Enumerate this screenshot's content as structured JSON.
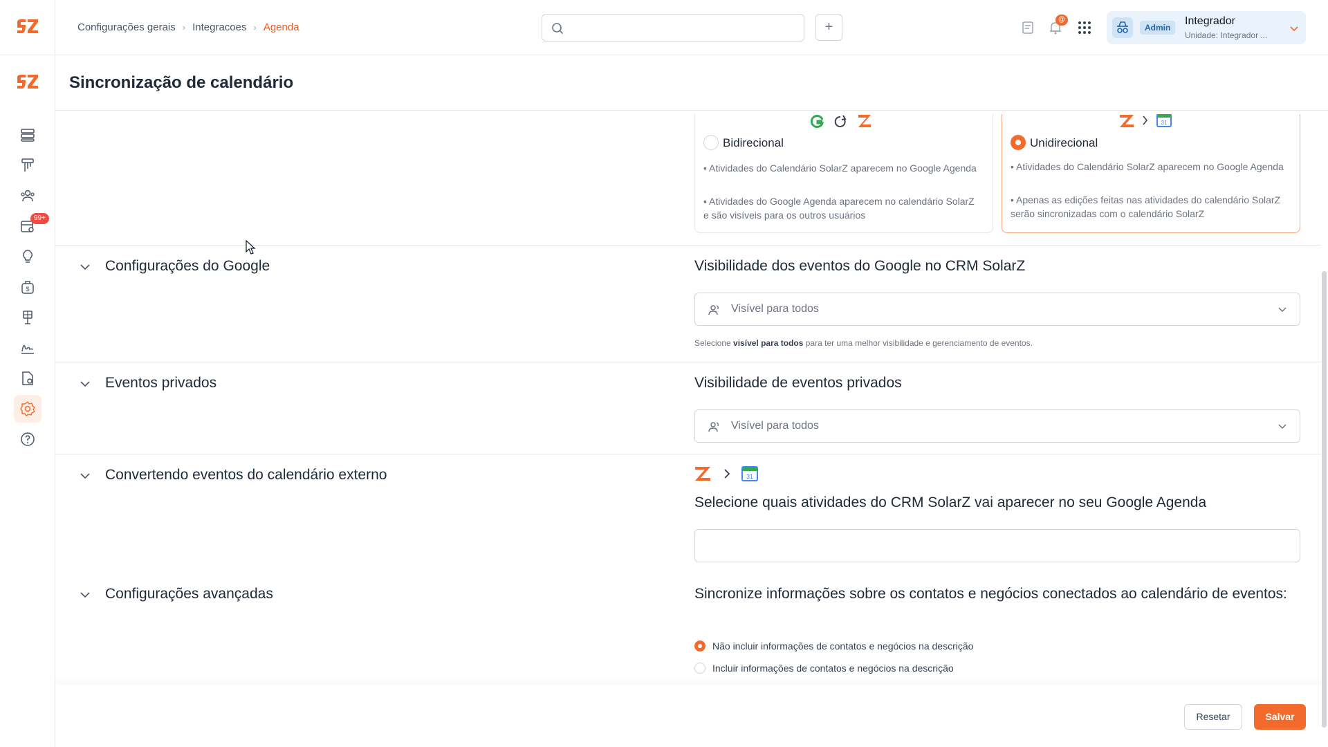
{
  "breadcrumb": {
    "items": [
      "Configurações gerais",
      "Integracoes"
    ],
    "current": "Agenda"
  },
  "search": {
    "placeholder": ""
  },
  "topbar": {
    "add_label": "+",
    "notif_badge": "@"
  },
  "user": {
    "role": "Admin",
    "name": "Integrador",
    "unit": "Unidade: Integrador ..."
  },
  "sidebar": {
    "badge": "99+"
  },
  "page": {
    "title": "Sincronização de calendário"
  },
  "sync_modes": {
    "bidirectional": {
      "label": "Bidirecional",
      "bullet1": "• Atividades do Calendário SolarZ aparecem no Google Agenda",
      "bullet2": "• Atividades do Google Agenda aparecem no calendário SolarZ e são visíveis para os outros usuários",
      "selected": false
    },
    "unidirectional": {
      "label": "Unidirecional",
      "bullet1": "• Atividades do Calendário SolarZ aparecem no Google Agenda",
      "bullet2": "• Apenas as edições feitas nas atividades do calendário SolarZ serão sincronizadas com o calendário SolarZ",
      "selected": true
    }
  },
  "google_settings": {
    "section_title": "Configurações do Google",
    "right_title": "Visibilidade dos eventos do Google no CRM SolarZ",
    "select_value": "Visível para todos",
    "help_prefix": "Selecione ",
    "help_bold": "visível para todos",
    "help_suffix": " para ter uma melhor visibilidade e gerenciamento de eventos."
  },
  "private_events": {
    "section_title": "Eventos privados",
    "right_title": "Visibilidade de eventos privados",
    "select_value": "Visível para todos"
  },
  "convert_events": {
    "section_title": "Convertendo eventos do calendário externo",
    "right_title": "Selecione quais atividades do CRM SolarZ vai aparecer no seu Google Agenda",
    "input_value": ""
  },
  "advanced": {
    "section_title": "Configurações avançadas",
    "right_title": "Sincronize informações sobre os contatos e negócios conectados ao calendário de eventos:",
    "option1": "Não incluir informações de contatos e negócios na descrição",
    "option2": "Incluir informações de contatos e negócios na descrição",
    "selected": 1
  },
  "footer": {
    "reset_label": "Resetar",
    "save_label": "Salvar"
  },
  "colors": {
    "accent": "#f26b2c",
    "link": "#ea5a1c",
    "admin": "#2563a6"
  }
}
